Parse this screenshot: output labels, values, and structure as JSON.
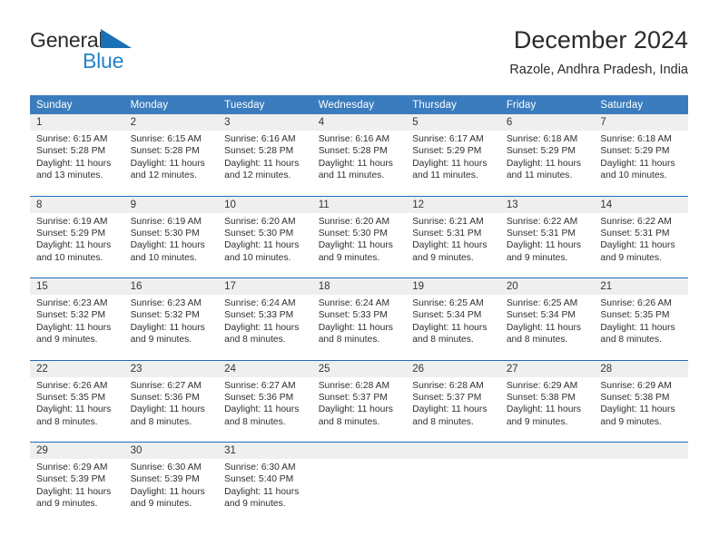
{
  "brand": {
    "name_part1": "General",
    "name_part2": "Blue",
    "triangle_icon": "triangle-icon",
    "accent_color": "#1a6fb5",
    "blue_text_color": "#2283c9"
  },
  "header": {
    "month_title": "December 2024",
    "location": "Razole, Andhra Pradesh, India"
  },
  "theme": {
    "header_bg": "#3b7cbe",
    "header_text": "#ffffff",
    "daynum_bg": "#efefef",
    "row_separator": "#1f6eb5",
    "cell_bg": "#ffffff"
  },
  "weekdays": [
    "Sunday",
    "Monday",
    "Tuesday",
    "Wednesday",
    "Thursday",
    "Friday",
    "Saturday"
  ],
  "weeks": [
    [
      {
        "day": "1",
        "sunrise": "Sunrise: 6:15 AM",
        "sunset": "Sunset: 5:28 PM",
        "daylight1": "Daylight: 11 hours",
        "daylight2": "and 13 minutes."
      },
      {
        "day": "2",
        "sunrise": "Sunrise: 6:15 AM",
        "sunset": "Sunset: 5:28 PM",
        "daylight1": "Daylight: 11 hours",
        "daylight2": "and 12 minutes."
      },
      {
        "day": "3",
        "sunrise": "Sunrise: 6:16 AM",
        "sunset": "Sunset: 5:28 PM",
        "daylight1": "Daylight: 11 hours",
        "daylight2": "and 12 minutes."
      },
      {
        "day": "4",
        "sunrise": "Sunrise: 6:16 AM",
        "sunset": "Sunset: 5:28 PM",
        "daylight1": "Daylight: 11 hours",
        "daylight2": "and 11 minutes."
      },
      {
        "day": "5",
        "sunrise": "Sunrise: 6:17 AM",
        "sunset": "Sunset: 5:29 PM",
        "daylight1": "Daylight: 11 hours",
        "daylight2": "and 11 minutes."
      },
      {
        "day": "6",
        "sunrise": "Sunrise: 6:18 AM",
        "sunset": "Sunset: 5:29 PM",
        "daylight1": "Daylight: 11 hours",
        "daylight2": "and 11 minutes."
      },
      {
        "day": "7",
        "sunrise": "Sunrise: 6:18 AM",
        "sunset": "Sunset: 5:29 PM",
        "daylight1": "Daylight: 11 hours",
        "daylight2": "and 10 minutes."
      }
    ],
    [
      {
        "day": "8",
        "sunrise": "Sunrise: 6:19 AM",
        "sunset": "Sunset: 5:29 PM",
        "daylight1": "Daylight: 11 hours",
        "daylight2": "and 10 minutes."
      },
      {
        "day": "9",
        "sunrise": "Sunrise: 6:19 AM",
        "sunset": "Sunset: 5:30 PM",
        "daylight1": "Daylight: 11 hours",
        "daylight2": "and 10 minutes."
      },
      {
        "day": "10",
        "sunrise": "Sunrise: 6:20 AM",
        "sunset": "Sunset: 5:30 PM",
        "daylight1": "Daylight: 11 hours",
        "daylight2": "and 10 minutes."
      },
      {
        "day": "11",
        "sunrise": "Sunrise: 6:20 AM",
        "sunset": "Sunset: 5:30 PM",
        "daylight1": "Daylight: 11 hours",
        "daylight2": "and 9 minutes."
      },
      {
        "day": "12",
        "sunrise": "Sunrise: 6:21 AM",
        "sunset": "Sunset: 5:31 PM",
        "daylight1": "Daylight: 11 hours",
        "daylight2": "and 9 minutes."
      },
      {
        "day": "13",
        "sunrise": "Sunrise: 6:22 AM",
        "sunset": "Sunset: 5:31 PM",
        "daylight1": "Daylight: 11 hours",
        "daylight2": "and 9 minutes."
      },
      {
        "day": "14",
        "sunrise": "Sunrise: 6:22 AM",
        "sunset": "Sunset: 5:31 PM",
        "daylight1": "Daylight: 11 hours",
        "daylight2": "and 9 minutes."
      }
    ],
    [
      {
        "day": "15",
        "sunrise": "Sunrise: 6:23 AM",
        "sunset": "Sunset: 5:32 PM",
        "daylight1": "Daylight: 11 hours",
        "daylight2": "and 9 minutes."
      },
      {
        "day": "16",
        "sunrise": "Sunrise: 6:23 AM",
        "sunset": "Sunset: 5:32 PM",
        "daylight1": "Daylight: 11 hours",
        "daylight2": "and 9 minutes."
      },
      {
        "day": "17",
        "sunrise": "Sunrise: 6:24 AM",
        "sunset": "Sunset: 5:33 PM",
        "daylight1": "Daylight: 11 hours",
        "daylight2": "and 8 minutes."
      },
      {
        "day": "18",
        "sunrise": "Sunrise: 6:24 AM",
        "sunset": "Sunset: 5:33 PM",
        "daylight1": "Daylight: 11 hours",
        "daylight2": "and 8 minutes."
      },
      {
        "day": "19",
        "sunrise": "Sunrise: 6:25 AM",
        "sunset": "Sunset: 5:34 PM",
        "daylight1": "Daylight: 11 hours",
        "daylight2": "and 8 minutes."
      },
      {
        "day": "20",
        "sunrise": "Sunrise: 6:25 AM",
        "sunset": "Sunset: 5:34 PM",
        "daylight1": "Daylight: 11 hours",
        "daylight2": "and 8 minutes."
      },
      {
        "day": "21",
        "sunrise": "Sunrise: 6:26 AM",
        "sunset": "Sunset: 5:35 PM",
        "daylight1": "Daylight: 11 hours",
        "daylight2": "and 8 minutes."
      }
    ],
    [
      {
        "day": "22",
        "sunrise": "Sunrise: 6:26 AM",
        "sunset": "Sunset: 5:35 PM",
        "daylight1": "Daylight: 11 hours",
        "daylight2": "and 8 minutes."
      },
      {
        "day": "23",
        "sunrise": "Sunrise: 6:27 AM",
        "sunset": "Sunset: 5:36 PM",
        "daylight1": "Daylight: 11 hours",
        "daylight2": "and 8 minutes."
      },
      {
        "day": "24",
        "sunrise": "Sunrise: 6:27 AM",
        "sunset": "Sunset: 5:36 PM",
        "daylight1": "Daylight: 11 hours",
        "daylight2": "and 8 minutes."
      },
      {
        "day": "25",
        "sunrise": "Sunrise: 6:28 AM",
        "sunset": "Sunset: 5:37 PM",
        "daylight1": "Daylight: 11 hours",
        "daylight2": "and 8 minutes."
      },
      {
        "day": "26",
        "sunrise": "Sunrise: 6:28 AM",
        "sunset": "Sunset: 5:37 PM",
        "daylight1": "Daylight: 11 hours",
        "daylight2": "and 8 minutes."
      },
      {
        "day": "27",
        "sunrise": "Sunrise: 6:29 AM",
        "sunset": "Sunset: 5:38 PM",
        "daylight1": "Daylight: 11 hours",
        "daylight2": "and 9 minutes."
      },
      {
        "day": "28",
        "sunrise": "Sunrise: 6:29 AM",
        "sunset": "Sunset: 5:38 PM",
        "daylight1": "Daylight: 11 hours",
        "daylight2": "and 9 minutes."
      }
    ],
    [
      {
        "day": "29",
        "sunrise": "Sunrise: 6:29 AM",
        "sunset": "Sunset: 5:39 PM",
        "daylight1": "Daylight: 11 hours",
        "daylight2": "and 9 minutes."
      },
      {
        "day": "30",
        "sunrise": "Sunrise: 6:30 AM",
        "sunset": "Sunset: 5:39 PM",
        "daylight1": "Daylight: 11 hours",
        "daylight2": "and 9 minutes."
      },
      {
        "day": "31",
        "sunrise": "Sunrise: 6:30 AM",
        "sunset": "Sunset: 5:40 PM",
        "daylight1": "Daylight: 11 hours",
        "daylight2": "and 9 minutes."
      },
      {
        "day": "",
        "sunrise": "",
        "sunset": "",
        "daylight1": "",
        "daylight2": ""
      },
      {
        "day": "",
        "sunrise": "",
        "sunset": "",
        "daylight1": "",
        "daylight2": ""
      },
      {
        "day": "",
        "sunrise": "",
        "sunset": "",
        "daylight1": "",
        "daylight2": ""
      },
      {
        "day": "",
        "sunrise": "",
        "sunset": "",
        "daylight1": "",
        "daylight2": ""
      }
    ]
  ]
}
